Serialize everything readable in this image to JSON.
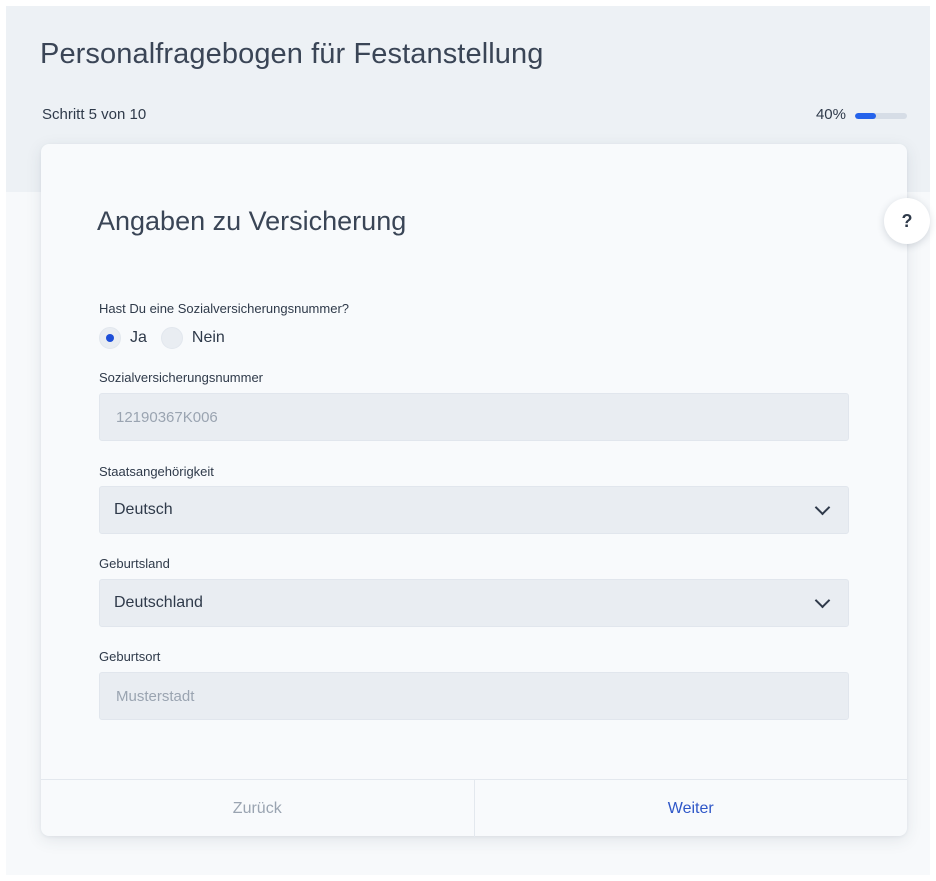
{
  "header": {
    "title": "Personalfragebogen für Festanstellung",
    "step_label": "Schritt 5 von 10",
    "progress_label": "40%",
    "progress_fraction": 0.4
  },
  "help": {
    "label": "?"
  },
  "section": {
    "title": "Angaben zu Versicherung",
    "question": "Hast Du eine Sozialversicherungsnummer?",
    "options": [
      {
        "label": "Ja",
        "selected": true
      },
      {
        "label": "Nein",
        "selected": false
      }
    ]
  },
  "fields": {
    "svn_label": "Sozialversicherungsnummer",
    "svn_placeholder": "12190367K006",
    "nationality_label": "Staatsangehörigkeit",
    "nationality_value": "Deutsch",
    "birth_country_label": "Geburtsland",
    "birth_country_value": "Deutschland",
    "birth_place_label": "Geburtsort",
    "birth_place_placeholder": "Musterstadt"
  },
  "footer": {
    "back_label": "Zurück",
    "next_label": "Weiter"
  },
  "colors": {
    "accent": "#2563eb",
    "next_text": "#2f57c8",
    "field_bg": "#e9edf2"
  }
}
